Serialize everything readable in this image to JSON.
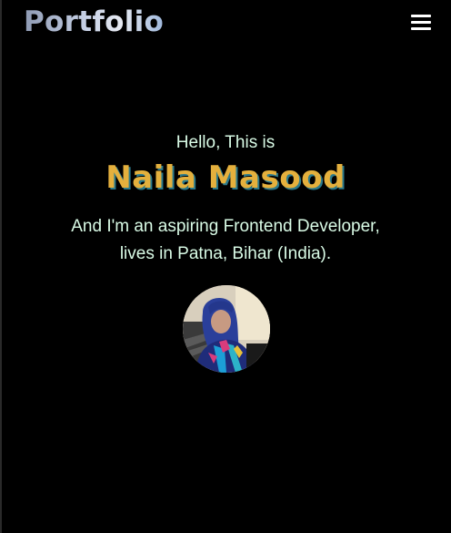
{
  "navbar": {
    "brand": "Portfolio",
    "menu_icon": "hamburger-menu-icon"
  },
  "hero": {
    "greeting": "Hello, This is",
    "name": "Naila Masood",
    "tagline_line1": "And I'm an aspiring Frontend Developer,",
    "tagline_line2": "lives in Patna, Bihar (India)."
  },
  "colors": {
    "background": "#000000",
    "text": "#d9fbe6",
    "name": "#e4b03d",
    "name_shadow": "#2b7a8c"
  }
}
